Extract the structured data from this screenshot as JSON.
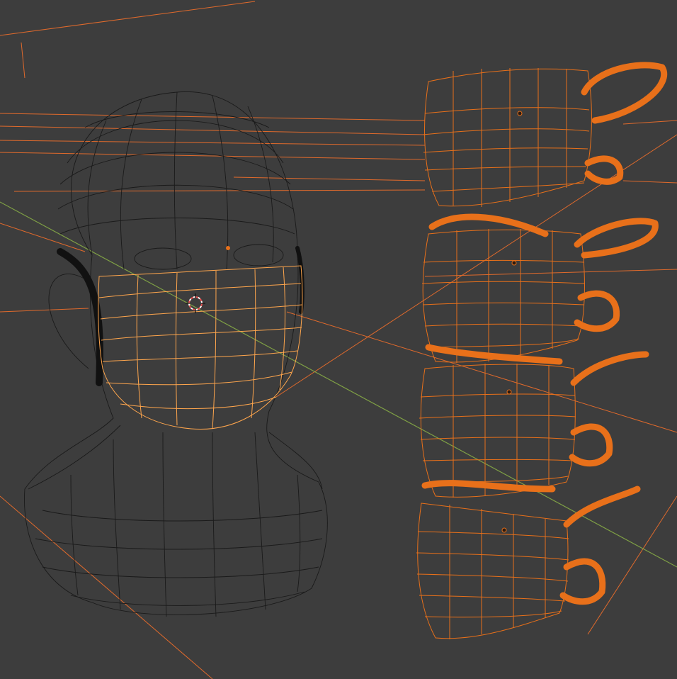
{
  "viewport": {
    "background_color": "#3d3d3d",
    "wire_color_unselected": "#1a1a1a",
    "wire_color_selected": "#ffa64d",
    "wire_color_active_copies": "#e8701a",
    "axis_x_color": "#c8503c",
    "axis_y_color": "#7fa045"
  },
  "objects": {
    "head": {
      "kind": "mesh",
      "state": "unselected"
    },
    "mask_on_head": {
      "kind": "mesh",
      "state": "selected-active"
    },
    "ear_loops_on_head": {
      "kind": "mesh",
      "state": "unselected"
    },
    "mask_copies": [
      {
        "kind": "mesh",
        "state": "selected"
      },
      {
        "kind": "mesh",
        "state": "selected"
      },
      {
        "kind": "mesh",
        "state": "selected"
      },
      {
        "kind": "mesh",
        "state": "selected"
      }
    ]
  },
  "widgets": {
    "cursor_3d": "3d-cursor-icon",
    "origin_points": "origin-dot-icon"
  }
}
